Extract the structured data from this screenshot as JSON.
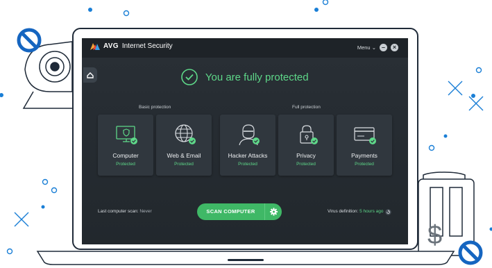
{
  "app": {
    "brand": "AVG",
    "product": "Internet Security",
    "menu_label": "Menu",
    "menu_caret": "⌄",
    "minimize_glyph": "–",
    "close_glyph": "×"
  },
  "status": {
    "headline": "You are fully protected"
  },
  "groups": {
    "basic_label": "Basic protection",
    "full_label": "Full protection"
  },
  "tiles": [
    {
      "name": "Computer",
      "status": "Protected",
      "icon": "monitor-shield-icon"
    },
    {
      "name": "Web & Email",
      "status": "Protected",
      "icon": "globe-icon"
    },
    {
      "name": "Hacker Attacks",
      "status": "Protected",
      "icon": "hacker-icon"
    },
    {
      "name": "Privacy",
      "status": "Protected",
      "icon": "lock-icon"
    },
    {
      "name": "Payments",
      "status": "Protected",
      "icon": "credit-card-icon"
    }
  ],
  "footer": {
    "last_scan_label": "Last computer scan:",
    "last_scan_value": "Never",
    "scan_button": "SCAN COMPUTER",
    "virus_def_label": "Virus definition:",
    "virus_def_value": "5 hours ago"
  },
  "decor": {
    "dollar_sign": "$"
  },
  "colors": {
    "accent_green": "#5ed889",
    "button_green": "#3fb866",
    "app_background": "#262c32",
    "tile_background": "#30373e",
    "decor_blue": "#1a7fd6",
    "blocked_icon_blue": "#1565c0"
  }
}
